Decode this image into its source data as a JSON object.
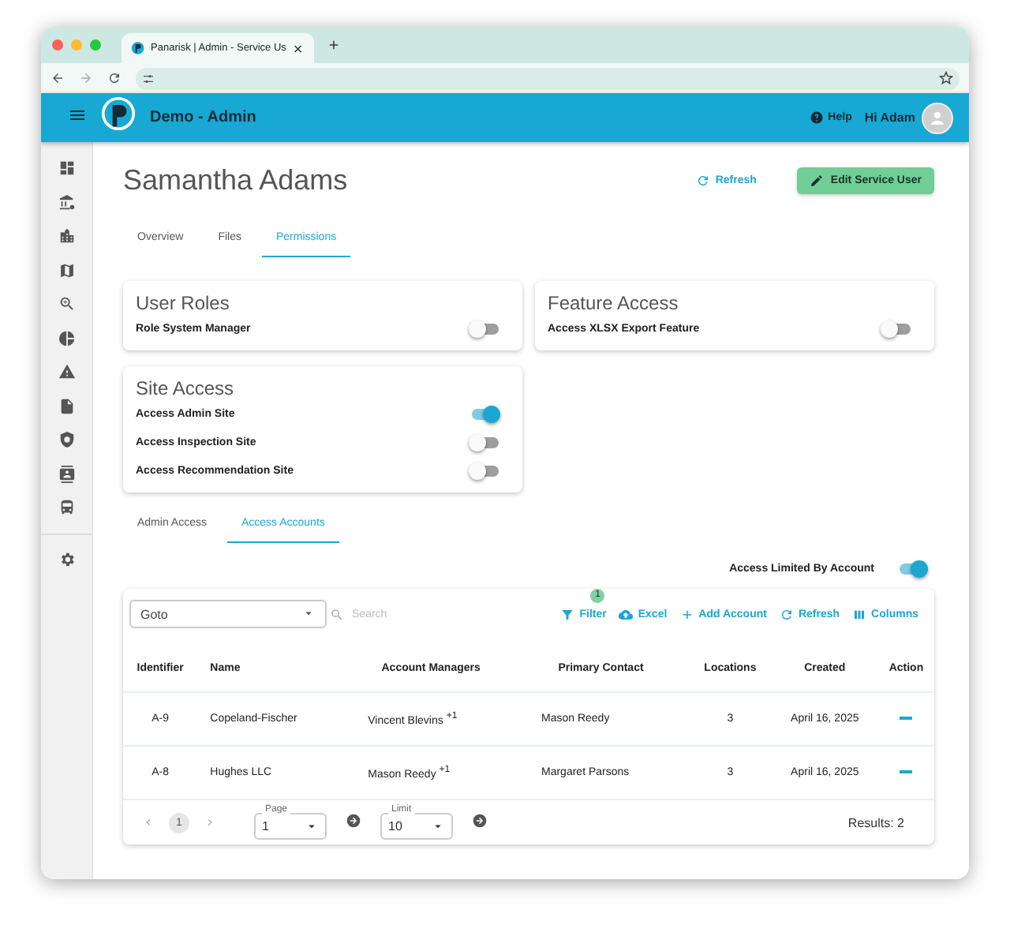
{
  "browser": {
    "tab_title": "Panarisk | Admin - Service Us"
  },
  "header": {
    "title": "Demo - Admin",
    "help": "Help",
    "greeting": "Hi Adam"
  },
  "page": {
    "title": "Samantha Adams",
    "refresh": "Refresh",
    "edit": "Edit Service User"
  },
  "tabs": [
    {
      "label": "Overview",
      "selected": false
    },
    {
      "label": "Files",
      "selected": false
    },
    {
      "label": "Permissions",
      "selected": true
    }
  ],
  "cards": [
    {
      "title": "User Roles",
      "toggles": [
        {
          "label": "Role System Manager",
          "on": false
        }
      ]
    },
    {
      "title": "Feature Access",
      "toggles": [
        {
          "label": "Access XLSX Export Feature",
          "on": false
        }
      ]
    },
    {
      "title": "Site Access",
      "toggles": [
        {
          "label": "Access Admin Site",
          "on": true
        },
        {
          "label": "Access Inspection Site",
          "on": false
        },
        {
          "label": "Access Recommendation Site",
          "on": false
        }
      ]
    }
  ],
  "sub_tabs": [
    {
      "label": "Admin Access",
      "selected": false
    },
    {
      "label": "Access Accounts",
      "selected": true
    }
  ],
  "access_limited": {
    "label": "Access Limited By Account",
    "on": true
  },
  "table": {
    "goto": "Goto",
    "search_placeholder": "Search",
    "toolbar": [
      {
        "kind": "filter",
        "label": "Filter",
        "badge": {
          "text": "1",
          "color": "#7fd1a1"
        }
      },
      {
        "kind": "excel",
        "label": "Excel"
      },
      {
        "kind": "add",
        "label": "Add Account"
      },
      {
        "kind": "refresh",
        "label": "Refresh"
      },
      {
        "kind": "columns",
        "label": "Columns"
      }
    ],
    "columns": [
      "Identifier",
      "Name",
      "Account Managers",
      "Primary Contact",
      "Locations",
      "Created",
      "Action"
    ],
    "rows": [
      [
        "A-9",
        "Copeland-Fischer",
        "Vincent Blevins $^{+1}$",
        "Mason Reedy",
        "3",
        "April 16, 2025"
      ],
      [
        "A-8",
        "Hughes LLC",
        "Mason Reedy $^{+1}$",
        "Margaret Parsons",
        "3",
        "April 16, 2025"
      ]
    ],
    "pages": [
      {
        "label": "1",
        "selected": true
      }
    ],
    "page_field": {
      "label": "Page",
      "value": "1"
    },
    "limit_field": {
      "label": "Limit",
      "value": "10"
    },
    "results": "Results: 2"
  }
}
